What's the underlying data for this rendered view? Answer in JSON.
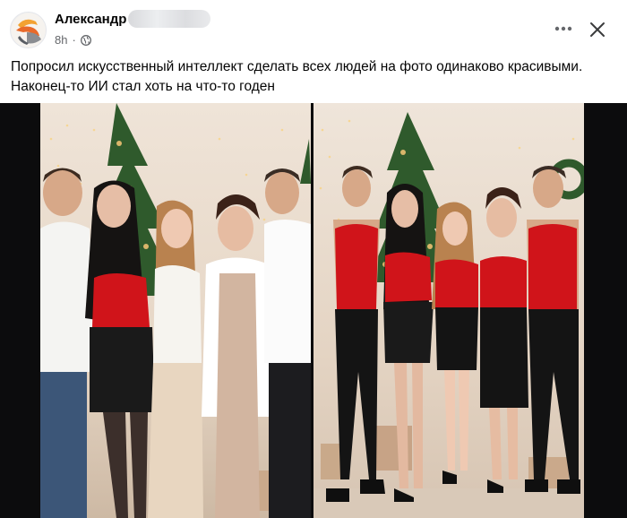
{
  "post": {
    "author": {
      "name": "Александр",
      "avatar_icon": "avatar-logo-icon"
    },
    "meta": {
      "time": "8h",
      "separator": "·",
      "privacy_icon": "globe-icon"
    },
    "actions": {
      "more_icon": "more-horizontal-icon",
      "close_icon": "close-icon"
    },
    "text": {
      "line1": "Попросил искусственный интеллект сделать всех людей на фото одинаково красивыми.",
      "line2": "Наконец-то ИИ стал хоть на что-то годен"
    },
    "media": {
      "images": [
        {
          "icon": "family-photo-original"
        },
        {
          "icon": "family-photo-ai-edited"
        }
      ]
    }
  },
  "colors": {
    "text_primary": "#050505",
    "text_secondary": "#65676b",
    "media_background": "#0c0c0d",
    "red_dress": "#d0141a"
  }
}
